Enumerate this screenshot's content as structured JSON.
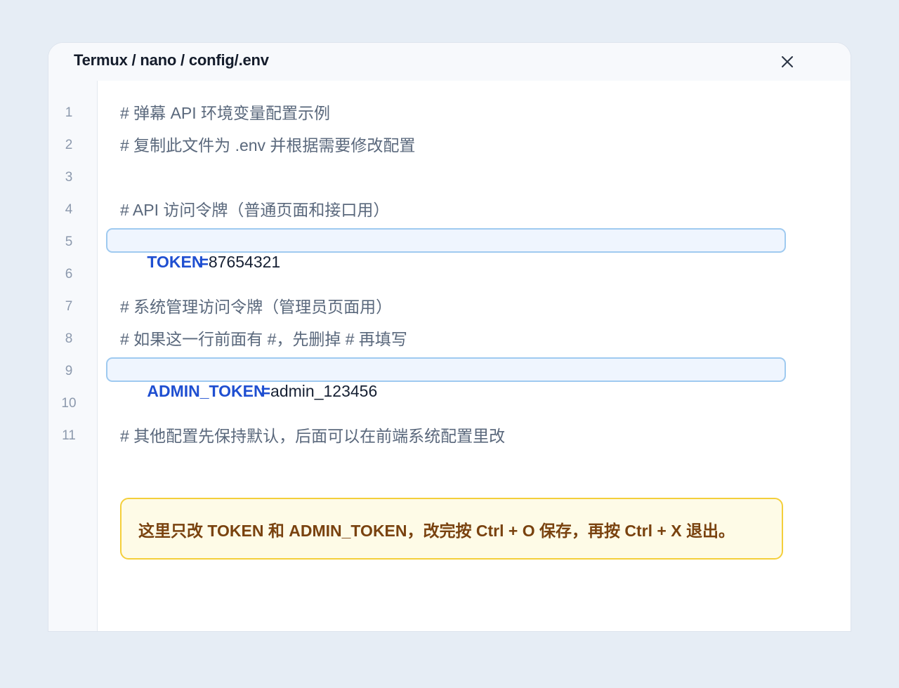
{
  "window": {
    "title": "Termux / nano / config/.env",
    "close_icon": "close-icon"
  },
  "editor": {
    "line_numbers": [
      "1",
      "2",
      "3",
      "4",
      "5",
      "6",
      "7",
      "8",
      "9",
      "10",
      "11"
    ],
    "lines": {
      "l1": "# 弹幕 API 环境变量配置示例",
      "l2": "# 复制此文件为 .env 并根据需要修改配置",
      "l4": "# API 访问令牌（普通页面和接口用）",
      "l5_key": "TOKEN",
      "l5_eq": "=",
      "l5_val": "87654321",
      "l7": "# 系统管理访问令牌（管理员页面用）",
      "l8": "# 如果这一行前面有 #，先删掉 # 再填写",
      "l9_key": "ADMIN_TOKEN",
      "l9_eq": "=",
      "l9_val": "admin_123456",
      "l11": "# 其他配置先保持默认，后面可以在前端系统配置里改"
    }
  },
  "notice": {
    "text": "这里只改 TOKEN 和 ADMIN_TOKEN，改完按 Ctrl + O 保存，再按 Ctrl + X 退出。"
  },
  "colors": {
    "background": "#e6edf5",
    "key": "#1f4fd1",
    "comment": "#5a687c",
    "highlight_fill": "#eff5fe",
    "highlight_border": "#9fcaf0",
    "notice_fill": "#fefbe7",
    "notice_border": "#f4cf3b",
    "notice_text": "#79420f"
  }
}
